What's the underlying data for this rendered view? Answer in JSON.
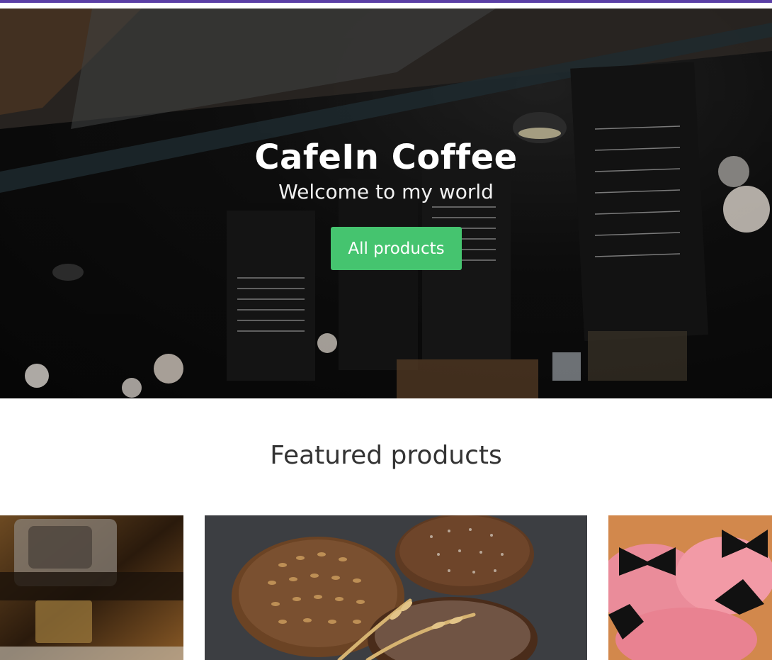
{
  "hero": {
    "title": "CafeIn Coffee",
    "subtitle": "Welcome to my world",
    "button_label": "All products"
  },
  "featured": {
    "title": "Featured products",
    "items": [
      {
        "image": "espresso-machine-photo"
      },
      {
        "image": "bread-loaves-photo"
      },
      {
        "image": "pink-cupcakes-photo"
      }
    ]
  },
  "colors": {
    "accent": "#5b3fa6",
    "button": "#45c46f",
    "heading": "#333333"
  }
}
